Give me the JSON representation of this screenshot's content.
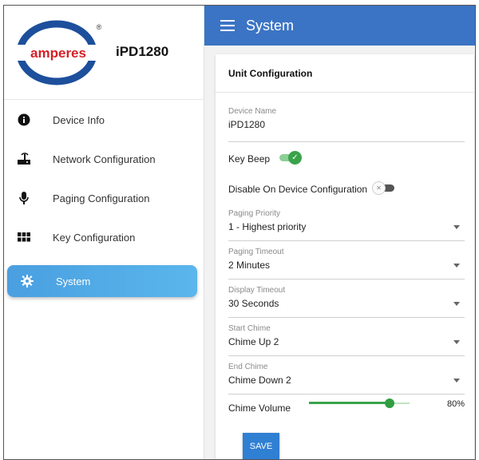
{
  "brand": {
    "logo_text": "amperes",
    "registered_mark": "®",
    "model": "iPD1280"
  },
  "sidebar": {
    "items": [
      {
        "label": "Device Info",
        "icon": "info-icon"
      },
      {
        "label": "Network Configuration",
        "icon": "network-icon"
      },
      {
        "label": "Paging Configuration",
        "icon": "microphone-icon"
      },
      {
        "label": "Key Configuration",
        "icon": "keypad-icon"
      },
      {
        "label": "System",
        "icon": "gear-icon",
        "active": true
      }
    ]
  },
  "header": {
    "title": "System"
  },
  "card": {
    "title": "Unit Configuration",
    "device_name": {
      "label": "Device Name",
      "value": "iPD1280"
    },
    "key_beep": {
      "label": "Key Beep",
      "enabled": true
    },
    "disable_device_config": {
      "label": "Disable On Device Configuration",
      "enabled": false
    },
    "paging_priority": {
      "label": "Paging Priority",
      "value": "1 - Highest priority"
    },
    "paging_timeout": {
      "label": "Paging Timeout",
      "value": "2 Minutes"
    },
    "display_timeout": {
      "label": "Display Timeout",
      "value": "30 Seconds"
    },
    "start_chime": {
      "label": "Start Chime",
      "value": "Chime Up 2"
    },
    "end_chime": {
      "label": "End Chime",
      "value": "Chime Down 2"
    },
    "chime_volume": {
      "label": "Chime Volume",
      "value": 80,
      "display": "80%"
    }
  },
  "actions": {
    "save_label": "SAVE"
  },
  "colors": {
    "topbar": "#3b74c4",
    "active_nav": "#4a9fe0",
    "toggle_on": "#3aa34a",
    "save_button": "#2f7fd3",
    "logo_red": "#d42027",
    "logo_blue": "#1d4f9c"
  }
}
